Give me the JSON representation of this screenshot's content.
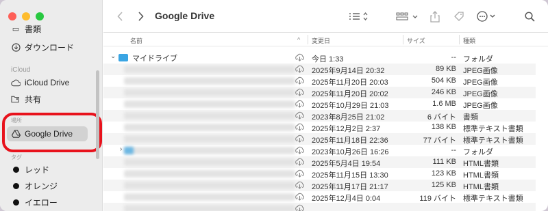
{
  "sidebar": {
    "top_item_partial": "書類",
    "downloads": "ダウンロード",
    "section_icloud": "iCloud",
    "icloud_drive": "iCloud Drive",
    "shared": "共有",
    "section_places": "場所",
    "google_drive": "Google Drive",
    "section_tags": "タグ",
    "tags": [
      "レッド",
      "オレンジ",
      "イエロー"
    ]
  },
  "toolbar": {
    "title": "Google Drive",
    "back_icon": "chevron-left",
    "forward_icon": "chevron-right",
    "list_view_icon": "list",
    "group_icon": "grid",
    "share_icon": "share",
    "tag_icon": "tag",
    "action_icon": "ellipsis-circle",
    "search_icon": "magnifier"
  },
  "columns": {
    "name": "名前",
    "date": "変更日",
    "size": "サイズ",
    "kind": "種類"
  },
  "rows": [
    {
      "name": "マイドライブ",
      "date": "今日 1:33",
      "size": "--",
      "kind": "フォルダ",
      "folder": true,
      "expanded": true
    },
    {
      "name": "",
      "date": "2025年9月14日 20:32",
      "size": "89 KB",
      "kind": "JPEG画像"
    },
    {
      "name": "",
      "date": "2025年11月20日 20:03",
      "size": "504 KB",
      "kind": "JPEG画像"
    },
    {
      "name": "",
      "date": "2025年11月20日 20:02",
      "size": "246 KB",
      "kind": "JPEG画像"
    },
    {
      "name": "",
      "date": "2025年10月29日 21:03",
      "size": "1.6 MB",
      "kind": "JPEG画像"
    },
    {
      "name": "",
      "date": "2023年8月25日 21:02",
      "size": "6 バイト",
      "kind": "書類"
    },
    {
      "name": "",
      "date": "2025年12月2日 2:37",
      "size": "138 KB",
      "kind": "標準テキスト書類"
    },
    {
      "name": "",
      "date": "2025年11月18日 22:36",
      "size": "77 バイト",
      "kind": "標準テキスト書類"
    },
    {
      "name": "",
      "date": "2023年10月26日 16:26",
      "size": "--",
      "kind": "フォルダ",
      "folder": true
    },
    {
      "name": "",
      "date": "2025年5月4日 19:54",
      "size": "111 KB",
      "kind": "HTML書類"
    },
    {
      "name": "",
      "date": "2025年11月15日 13:30",
      "size": "123 KB",
      "kind": "HTML書類"
    },
    {
      "name": "",
      "date": "2025年11月17日 21:17",
      "size": "125 KB",
      "kind": "HTML書類"
    },
    {
      "name": "",
      "date": "2025年12月4日 0:04",
      "size": "119 バイト",
      "kind": "標準テキスト書類"
    },
    {
      "name": "",
      "date": "",
      "size": "",
      "kind": ""
    }
  ],
  "colors": {
    "highlight": "#e8121c",
    "folder": "#3aa5e3"
  }
}
